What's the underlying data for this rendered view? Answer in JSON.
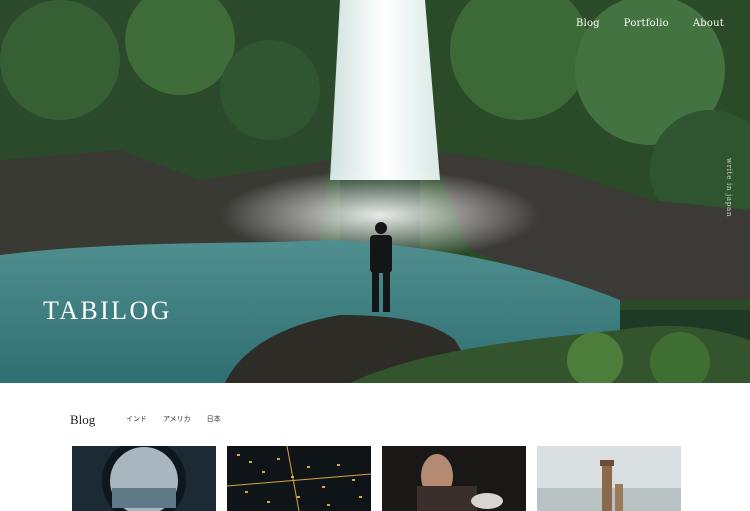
{
  "nav": {
    "items": [
      {
        "label": "Blog"
      },
      {
        "label": "Portfolio"
      },
      {
        "label": "About"
      }
    ]
  },
  "hero": {
    "brand": "TABILOG",
    "vertical_text": "write in japan"
  },
  "blog": {
    "title": "Blog",
    "filters": [
      {
        "label": "インド"
      },
      {
        "label": "アメリカ"
      },
      {
        "label": "日本"
      }
    ]
  },
  "colors": {
    "hero_text": "#ffffff",
    "page_background": "#ffffff"
  }
}
